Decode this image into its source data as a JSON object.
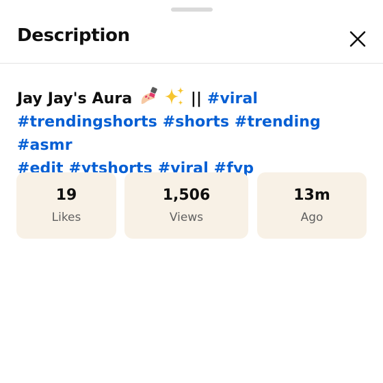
{
  "header": {
    "title": "Description",
    "close_icon": "close-icon"
  },
  "description": {
    "text_prefix": "Jay Jay's Aura",
    "emoji": [
      "nail-polish-emoji",
      "sparkles-emoji"
    ],
    "separator": "||",
    "hashtags": [
      "#viral",
      "#trendingshorts",
      "#shorts",
      "#trending",
      "#asmr",
      "#edit",
      "#ytshorts",
      "#viral",
      "#fyp"
    ]
  },
  "stats": [
    {
      "value": "19",
      "label": "Likes"
    },
    {
      "value": "1,506",
      "label": "Views"
    },
    {
      "value": "13m",
      "label": "Ago"
    }
  ],
  "colors": {
    "link": "#065fd4",
    "stat_bg": "#f8f1e6",
    "secondary_text": "#606060"
  }
}
